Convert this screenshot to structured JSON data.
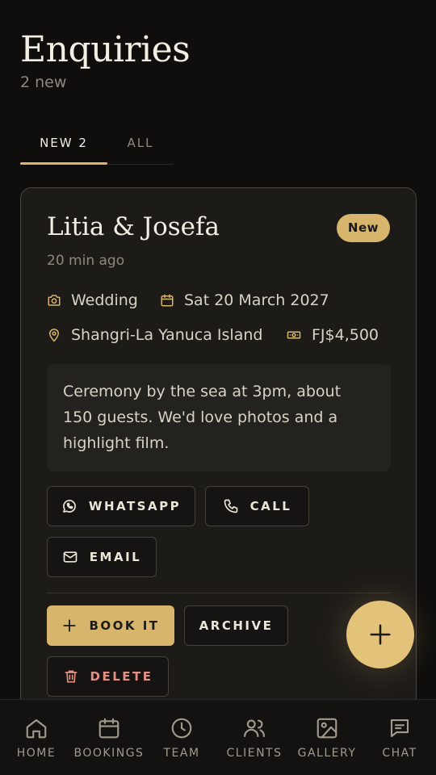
{
  "header": {
    "title": "Enquiries",
    "subtitle": "2 new"
  },
  "tabs": [
    {
      "label": "NEW 2",
      "active": true
    },
    {
      "label": "ALL",
      "active": false
    }
  ],
  "enquiry": {
    "name": "Litia & Josefa",
    "badge": "New",
    "time": "20 min ago",
    "type": "Wedding",
    "date": "Sat 20 March 2027",
    "location": "Shangri-La Yanuca Island",
    "budget": "FJ$4,500",
    "message": "Ceremony by the sea at 3pm, about 150 guests. We'd love photos and a highlight film.",
    "actions": {
      "whatsapp": "WHATSAPP",
      "call": "CALL",
      "email": "EMAIL",
      "book": "BOOK IT",
      "archive": "ARCHIVE",
      "delete": "DELETE"
    }
  },
  "nav": [
    {
      "label": "HOME",
      "icon": "home-icon"
    },
    {
      "label": "BOOKINGS",
      "icon": "calendar-icon"
    },
    {
      "label": "TEAM",
      "icon": "clock-icon"
    },
    {
      "label": "CLIENTS",
      "icon": "users-icon"
    },
    {
      "label": "GALLERY",
      "icon": "image-icon"
    },
    {
      "label": "CHAT",
      "icon": "chat-icon"
    }
  ],
  "colors": {
    "accent": "#d7b56d",
    "background": "#0f0e0c",
    "card": "#1d1b18",
    "danger": "#e48f86"
  }
}
